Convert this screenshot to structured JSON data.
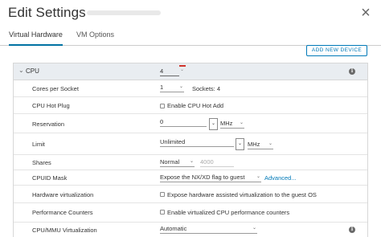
{
  "dialog": {
    "title": "Edit Settings",
    "close_glyph": "×"
  },
  "tabs": [
    {
      "label": "Virtual Hardware",
      "active": true
    },
    {
      "label": "VM Options",
      "active": false
    }
  ],
  "toolbar": {
    "add_device_label": "ADD NEW DEVICE"
  },
  "cpu": {
    "label": "CPU",
    "value": "4",
    "cores_per_socket": {
      "label": "Cores per Socket",
      "value": "1",
      "sockets_text": "Sockets: 4"
    },
    "hot_plug": {
      "label": "CPU Hot Plug",
      "checkbox_label": "Enable CPU Hot Add"
    },
    "reservation": {
      "label": "Reservation",
      "value": "0",
      "unit": "MHz"
    },
    "limit": {
      "label": "Limit",
      "value": "Unlimited",
      "unit": "MHz"
    },
    "shares": {
      "label": "Shares",
      "level": "Normal",
      "value": "4000"
    },
    "cpuid_mask": {
      "label": "CPUID Mask",
      "value": "Expose the NX/XD flag to guest",
      "link": "Advanced..."
    },
    "hw_virtualization": {
      "label": "Hardware virtualization",
      "checkbox_label": "Expose hardware assisted virtualization to the guest OS"
    },
    "perf_counters": {
      "label": "Performance Counters",
      "checkbox_label": "Enable virtualized CPU performance counters"
    },
    "mmu_virtualization": {
      "label": "CPU/MMU Virtualization",
      "value": "Automatic"
    }
  },
  "glyphs": {
    "caret": "⌄",
    "chevron": "⌄",
    "info": "i"
  }
}
